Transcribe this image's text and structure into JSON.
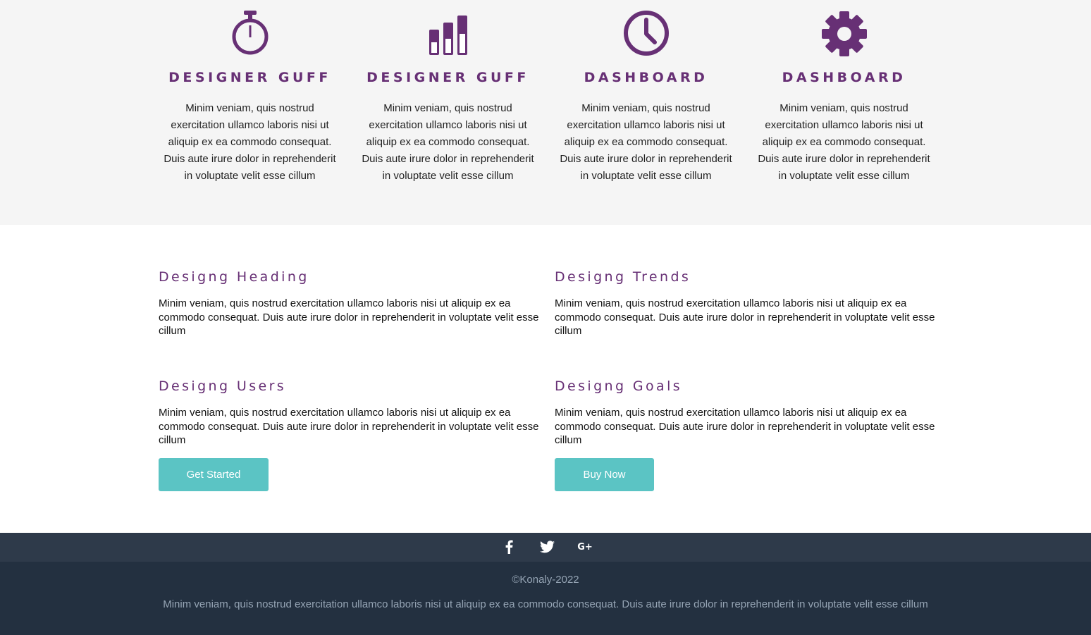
{
  "features": [
    {
      "icon": "stopwatch-icon",
      "title": "DESIGNER GUFF",
      "text": "Minim veniam, quis nostrud exercitation ullamco laboris nisi ut aliquip ex ea commodo consequat. Duis aute irure dolor in reprehenderit in voluptate velit esse cillum"
    },
    {
      "icon": "bar-chart-icon",
      "title": "DESIGNER GUFF",
      "text": "Minim veniam, quis nostrud exercitation ullamco laboris nisi ut aliquip ex ea commodo consequat. Duis aute irure dolor in reprehenderit in voluptate velit esse cillum"
    },
    {
      "icon": "clock-icon",
      "title": "DASHBOARD",
      "text": "Minim veniam, quis nostrud exercitation ullamco laboris nisi ut aliquip ex ea commodo consequat. Duis aute irure dolor in reprehenderit in voluptate velit esse cillum"
    },
    {
      "icon": "gear-icon",
      "title": "DASHBOARD",
      "text": "Minim veniam, quis nostrud exercitation ullamco laboris nisi ut aliquip ex ea commodo consequat. Duis aute irure dolor in reprehenderit in voluptate velit esse cillum"
    }
  ],
  "blocks": [
    {
      "heading": "Designg Heading",
      "text": "Minim veniam, quis nostrud exercitation ullamco laboris nisi ut aliquip ex ea commodo consequat. Duis aute irure dolor in reprehenderit in voluptate velit esse cillum"
    },
    {
      "heading": "Designg Trends",
      "text": "Minim veniam, quis nostrud exercitation ullamco laboris nisi ut aliquip ex ea commodo consequat. Duis aute irure dolor in reprehenderit in voluptate velit esse cillum"
    },
    {
      "heading": "Designg Users",
      "text": "Minim veniam, quis nostrud exercitation ullamco laboris nisi ut aliquip ex ea commodo consequat. Duis aute irure dolor in reprehenderit in voluptate velit esse cillum"
    },
    {
      "heading": "Designg Goals",
      "text": "Minim veniam, quis nostrud exercitation ullamco laboris nisi ut aliquip ex ea commodo consequat. Duis aute irure dolor in reprehenderit in voluptate velit esse cillum"
    }
  ],
  "buttons": {
    "get_started": "Get Started",
    "buy_now": "Buy Now"
  },
  "social": [
    "facebook-icon",
    "twitter-icon",
    "google-plus-icon"
  ],
  "social_labels": {
    "google_plus": "G+"
  },
  "footer": {
    "copyright": "©Konaly-2022",
    "text": "Minim veniam, quis nostrud exercitation ullamco laboris nisi ut aliquip ex ea commodo consequat. Duis aute irure dolor in reprehenderit in voluptate velit esse cillum"
  },
  "colors": {
    "accent": "#673075",
    "button": "#5bc4c4",
    "social_bar": "#2e3a4a",
    "footer": "#233040",
    "features_bg": "#f5f5f5"
  }
}
